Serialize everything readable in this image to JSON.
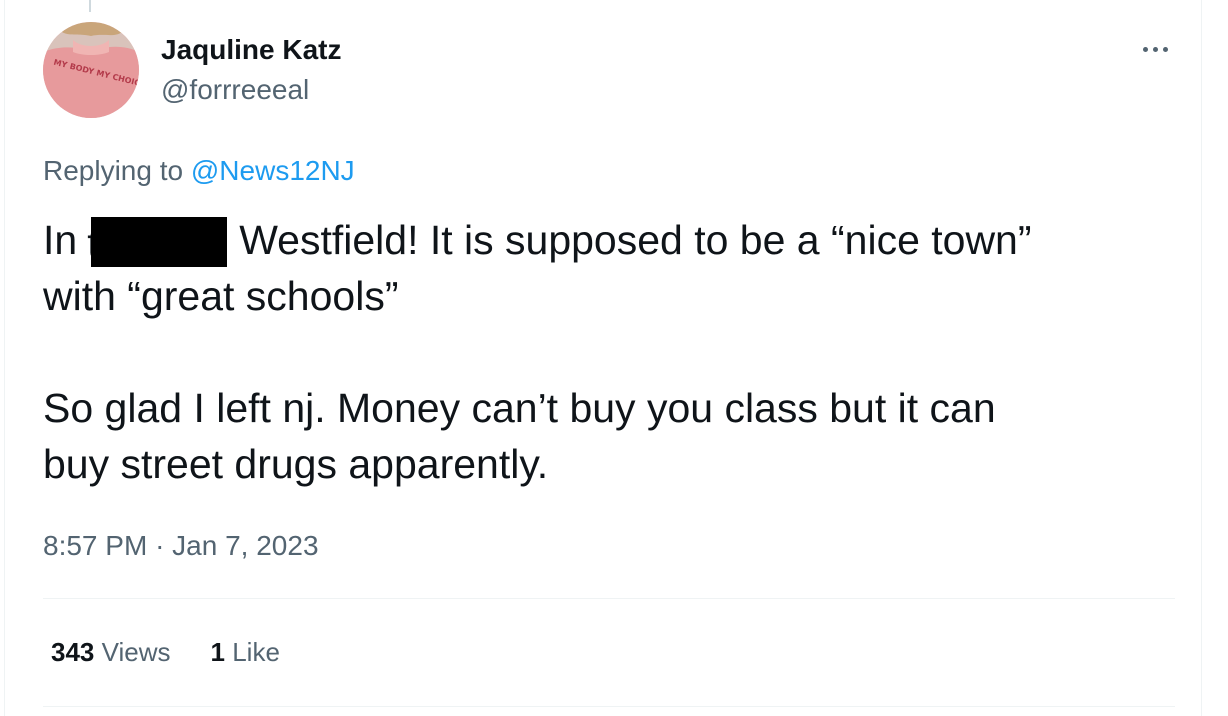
{
  "tweet": {
    "author": {
      "name": "Jaquline Katz",
      "handle": "@forrreeeal",
      "avatar_shirt_text": "MY BODY MY CHOICE"
    },
    "replying_prefix": "Replying to",
    "replying_to": "@News12NJ",
    "text": {
      "line1_start": "In",
      "redacted_leak": "t",
      "line1_end": "Westfield! It is supposed to be a “nice town”",
      "line2": "with “great schools”",
      "paragraph2_line1": "So glad I left nj. Money can’t buy you class but it can",
      "paragraph2_line2": "buy street drugs apparently."
    },
    "time": "8:57 PM",
    "separator": "·",
    "date": "Jan 7, 2023",
    "stats": {
      "views_count": "343",
      "views_label": "Views",
      "likes_count": "1",
      "likes_label": "Like"
    }
  },
  "colors": {
    "primary_text": "#0f1419",
    "secondary_text": "#536471",
    "link": "#1d9bf0",
    "divider": "#eff3f4",
    "redaction": "#000000"
  },
  "icons": {
    "more": "more-horizontal-icon"
  }
}
